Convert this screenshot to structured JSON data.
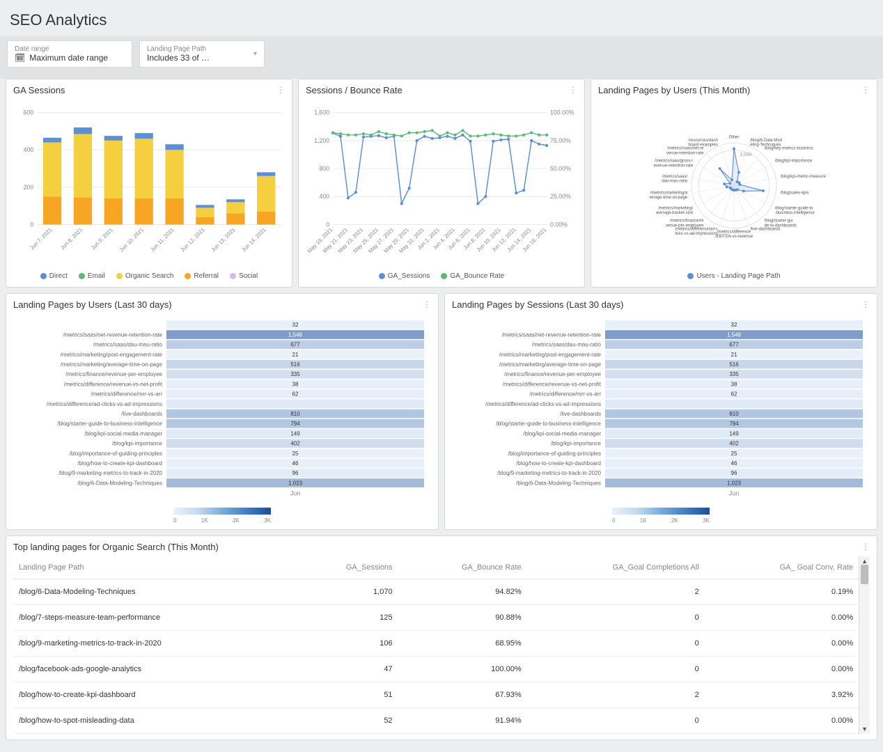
{
  "page": {
    "title": "SEO Analytics"
  },
  "filters": {
    "date_range": {
      "label": "Date range",
      "value": "Maximum date range"
    },
    "landing_page": {
      "label": "Landing Page Path",
      "value": "Includes 33 of …"
    }
  },
  "panels": {
    "ga_sessions": {
      "title": "GA Sessions"
    },
    "sessions_bounce": {
      "title": "Sessions / Bounce Rate"
    },
    "radar": {
      "title": "Landing Pages by Users (This Month)"
    },
    "heat_users": {
      "title": "Landing Pages by Users (Last 30 days)"
    },
    "heat_sessions": {
      "title": "Landing Pages by Sessions (Last 30 days)"
    },
    "organic": {
      "title": "Top landing pages for Organic Search (This Month)"
    }
  },
  "legend_labels": {
    "direct": "Direct",
    "email": "Email",
    "organic": "Organic Search",
    "referral": "Referral",
    "social": "Social",
    "ga_sessions": "GA_Sessions",
    "ga_bounce": "GA_Bounce Rate",
    "radar_series": "Users - Landing Page Path"
  },
  "gradient_ticks": [
    "0",
    "1K",
    "2K",
    "3K"
  ],
  "heatmap_month": "Jun",
  "radar_ring": "2,500",
  "chart_data": [
    {
      "id": "ga_sessions",
      "type": "bar-stacked",
      "categories": [
        "Jun 7, 2021",
        "Jun 8, 2021",
        "Jun 9, 2021",
        "Jun 10, 2021",
        "Jun 11, 2021",
        "Jun 12, 2021",
        "Jun 13, 2021",
        "Jun 14, 2021"
      ],
      "series": [
        {
          "name": "Referral",
          "color": "#f6a623",
          "values": [
            150,
            145,
            140,
            140,
            140,
            40,
            60,
            70
          ]
        },
        {
          "name": "Organic Search",
          "color": "#f4cf3f",
          "values": [
            290,
            340,
            310,
            320,
            260,
            50,
            60,
            190
          ]
        },
        {
          "name": "Email",
          "color": "#5bb97a",
          "values": [
            0,
            0,
            0,
            0,
            0,
            0,
            0,
            0
          ]
        },
        {
          "name": "Direct",
          "color": "#5b8fd6",
          "values": [
            25,
            35,
            25,
            30,
            30,
            15,
            15,
            20
          ]
        },
        {
          "name": "Social",
          "color": "#d7b8e8",
          "values": [
            0,
            0,
            0,
            0,
            0,
            0,
            0,
            0
          ]
        }
      ],
      "legend_order": [
        "Direct",
        "Email",
        "Organic Search",
        "Referral",
        "Social"
      ],
      "ylim": [
        0,
        600
      ],
      "yticks": [
        0,
        200,
        400,
        600
      ]
    },
    {
      "id": "sessions_bounce",
      "type": "dual-axis-line",
      "x": [
        "May 19, 2021",
        "May 21, 2021",
        "May 23, 2021",
        "May 25, 2021",
        "May 27, 2021",
        "May 29, 2021",
        "May 31, 2021",
        "Jun 2, 2021",
        "Jun 4, 2021",
        "Jun 6, 2021",
        "Jun 8, 2021",
        "Jun 10, 2021",
        "Jun 12, 2021",
        "Jun 14, 2021",
        "Jun 16, 2021"
      ],
      "series": [
        {
          "name": "GA_Sessions",
          "axis": "left",
          "color": "#5b8fd6",
          "values": [
            1310,
            1260,
            380,
            460,
            1250,
            1260,
            1270,
            1240,
            1260,
            300,
            520,
            1200,
            1260,
            1230,
            1240,
            1260,
            1230,
            1280,
            1190,
            300,
            400,
            1190,
            1210,
            1220,
            450,
            490,
            1200,
            1150,
            1130
          ]
        },
        {
          "name": "GA_Bounce Rate",
          "axis": "right",
          "color": "#5bb97a",
          "values": [
            82,
            81,
            80,
            80,
            81,
            80,
            83,
            81,
            80,
            79,
            82,
            82,
            83,
            84,
            79,
            82,
            80,
            84,
            79,
            79,
            80,
            81,
            80,
            79,
            79,
            80,
            82,
            80,
            80
          ]
        }
      ],
      "ylim_left": [
        0,
        1600
      ],
      "yticks_left": [
        0,
        400,
        800,
        1200,
        1600
      ],
      "ylim_right": [
        0,
        100
      ],
      "yticks_right": [
        "0.00%",
        "25.00%",
        "50.00%",
        "75.00%",
        "100.00%"
      ]
    },
    {
      "id": "radar",
      "type": "radar",
      "point_labels": [
        "Other",
        "/blog/6-Data-Modeling-Techniques",
        "/blog/key-metrics-business",
        "/blog/kpi-importance",
        "/blog/kpi-metric-measure",
        "/blog/sales-kpis",
        "/blog/starter-guide-to-business-intelligence",
        "/blog/starter-guide-to-dashboards",
        "/live-dashboards",
        "/metrics/difference/EBITDA-vs-revenue",
        "/metrics/difference/ad-clicks-vs-ad-impressions",
        "/metrics/finance/revenue-per-employee",
        "/metrics/marketing/average-basket-size",
        "/metrics/marketing/average-time-on-page",
        "/metrics/saas/dau-mau-ratio",
        "/metrics/saas/gross-revenue-retention-rate",
        "/metrics/saas/net-revenue-retention-rate",
        "/resources/dashboard-examples"
      ],
      "values": [
        2600,
        1000,
        350,
        420,
        420,
        2100,
        780,
        380,
        330,
        320,
        310,
        300,
        300,
        520,
        690,
        320,
        1560,
        430
      ],
      "max": 3000,
      "ring_at": 2500
    },
    {
      "id": "heat_users",
      "type": "heatmap",
      "rows": [
        "",
        "/metrics/saas/net-revenue-retention-rate",
        "/metrics/saas/dau-mau-ratio",
        "/metrics/marketing/post-engagement-rate",
        "/metrics/marketing/average-time-on-page",
        "/metrics/finance/revenue-per-employee",
        "/metrics/difference/revenue-vs-net-profit",
        "/metrics/difference/mrr-vs-arr",
        "/metrics/difference/ad-clicks-vs-ad-impressions",
        "/live-dashboards",
        "/blog/starter-guide-to-business-intelligence",
        "/blog/kpi-social-media-manager",
        "/blog/kpi-importance",
        "/blog/importance-of-guiding-principles",
        "/blog/how-to-create-kpi-dashboard",
        "/blog/9-marketing-metrics-to-track-in-2020",
        "/blog/6-Data-Modeling-Techniques"
      ],
      "values": [
        32,
        1548,
        677,
        21,
        516,
        335,
        38,
        62,
        null,
        810,
        794,
        149,
        402,
        25,
        46,
        96,
        1023
      ],
      "scale_max": 3000
    },
    {
      "id": "heat_sessions",
      "type": "heatmap",
      "rows": [
        "",
        "/metrics/saas/net-revenue-retention-rate",
        "/metrics/saas/dau-mau-ratio",
        "/metrics/marketing/post-engagement-rate",
        "/metrics/marketing/average-time-on-page",
        "/metrics/finance/revenue-per-employee",
        "/metrics/difference/revenue-vs-net-profit",
        "/metrics/difference/mrr-vs-arr",
        "/metrics/difference/ad-clicks-vs-ad-impressions",
        "/live-dashboards",
        "/blog/starter-guide-to-business-intelligence",
        "/blog/kpi-social-media-manager",
        "/blog/kpi-importance",
        "/blog/importance-of-guiding-principles",
        "/blog/how-to-create-kpi-dashboard",
        "/blog/9-marketing-metrics-to-track-in-2020",
        "/blog/6-Data-Modeling-Techniques"
      ],
      "values": [
        32,
        1548,
        677,
        21,
        516,
        335,
        38,
        62,
        null,
        810,
        794,
        149,
        402,
        25,
        46,
        96,
        1023
      ],
      "scale_max": 3000
    },
    {
      "id": "organic_table",
      "type": "table",
      "columns": [
        "Landing Page Path",
        "GA_Sessions",
        "GA_Bounce Rate",
        "GA_Goal Completions All",
        "GA_ Goal Conv. Rate"
      ],
      "rows": [
        [
          "/blog/6-Data-Modeling-Techniques",
          "1,070",
          "94.82%",
          "2",
          "0.19%"
        ],
        [
          "/blog/7-steps-measure-team-performance",
          "125",
          "90.88%",
          "0",
          "0.00%"
        ],
        [
          "/blog/9-marketing-metrics-to-track-in-2020",
          "106",
          "68.95%",
          "0",
          "0.00%"
        ],
        [
          "/blog/facebook-ads-google-analytics",
          "47",
          "100.00%",
          "0",
          "0.00%"
        ],
        [
          "/blog/how-to-create-kpi-dashboard",
          "51",
          "67.93%",
          "2",
          "3.92%"
        ],
        [
          "/blog/how-to-spot-misleading-data",
          "52",
          "91.94%",
          "0",
          "0.00%"
        ]
      ]
    }
  ]
}
